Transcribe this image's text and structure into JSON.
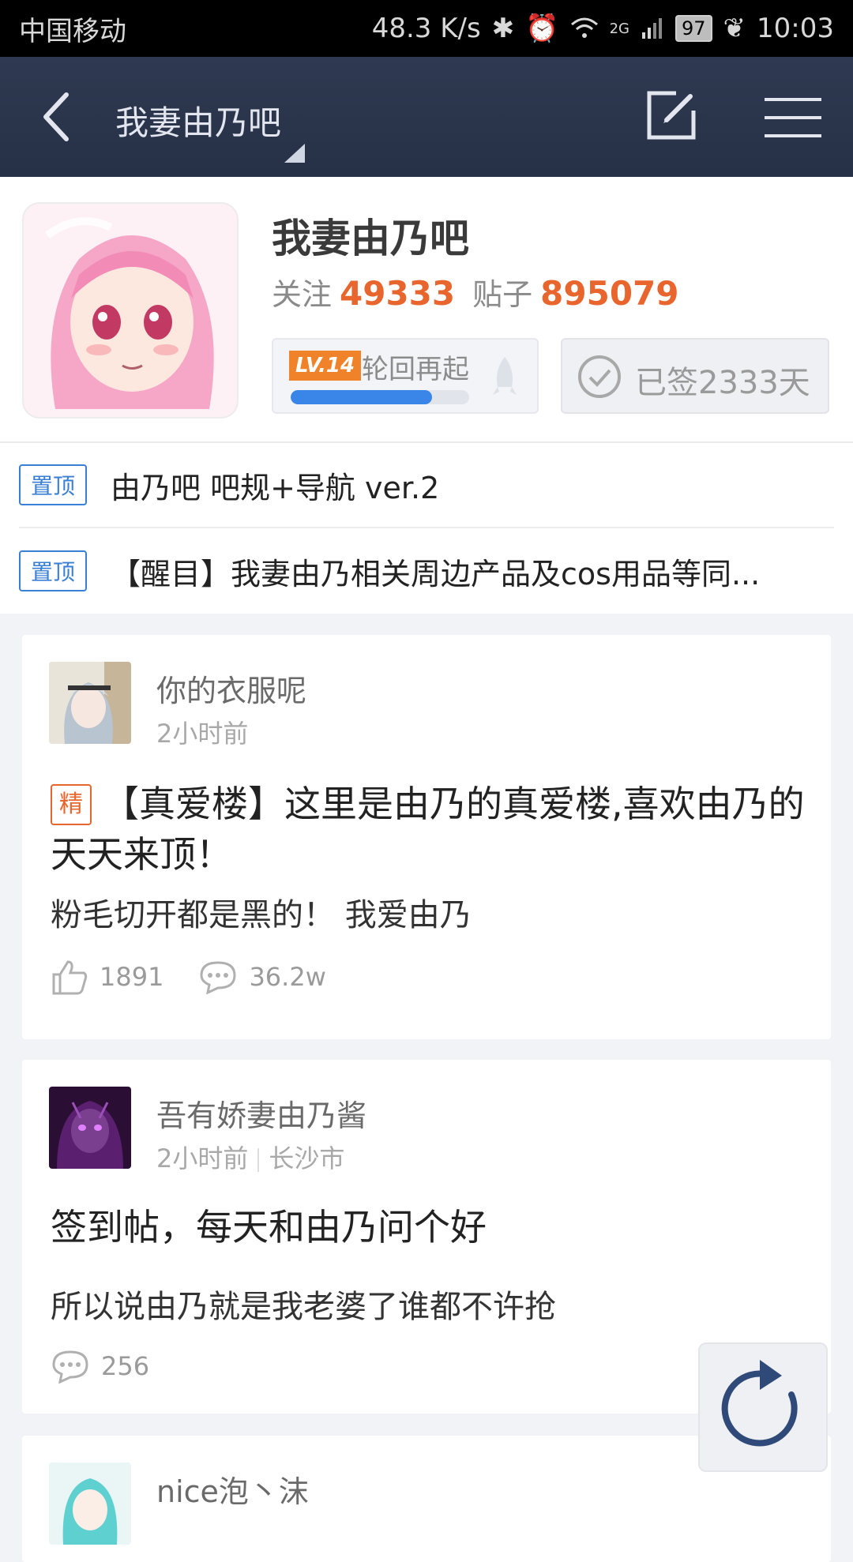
{
  "status_bar": {
    "carrier": "中国移动",
    "speed": "48.3 K/s",
    "network": "2G",
    "battery": "97",
    "time": "10:03"
  },
  "navbar": {
    "title": "我妻由乃吧",
    "icons": [
      "back-arrow-icon",
      "edit-icon",
      "menu-icon"
    ]
  },
  "forum": {
    "name": "我妻由乃吧",
    "follow_label": "关注",
    "follow_count": "49333",
    "posts_label": "贴子",
    "posts_count": "895079",
    "level_badge": "LV.14",
    "level_title": "轮回再起",
    "level_progress": 0.79,
    "signed_text": "已签2333天"
  },
  "pinned": [
    {
      "tag": "置顶",
      "text": "由乃吧 吧规+导航 ver.2"
    },
    {
      "tag": "置顶",
      "text": "【醒目】我妻由乃相关周边产品及cos用品等同..."
    }
  ],
  "posts": [
    {
      "author": "你的衣服呢",
      "time": "2小时前",
      "location": "",
      "featured_tag": "精",
      "title": "【真爱楼】这里是由乃的真爱楼,喜欢由乃的天天来顶！",
      "body": "粉毛切开都是黑的！ 我爱由乃",
      "likes": "1891",
      "comments": "36.2w"
    },
    {
      "author": "吾有娇妻由乃酱",
      "time": "2小时前",
      "location": "长沙市",
      "title": "签到帖，每天和由乃问个好",
      "body": "所以说由乃就是我老婆了谁都不许抢",
      "comments": "256"
    },
    {
      "author": "nice泡丶沫"
    }
  ],
  "colors": {
    "navbar": "#2b354c",
    "accent_orange": "#e8662e",
    "accent_blue": "#3a7fd6"
  }
}
